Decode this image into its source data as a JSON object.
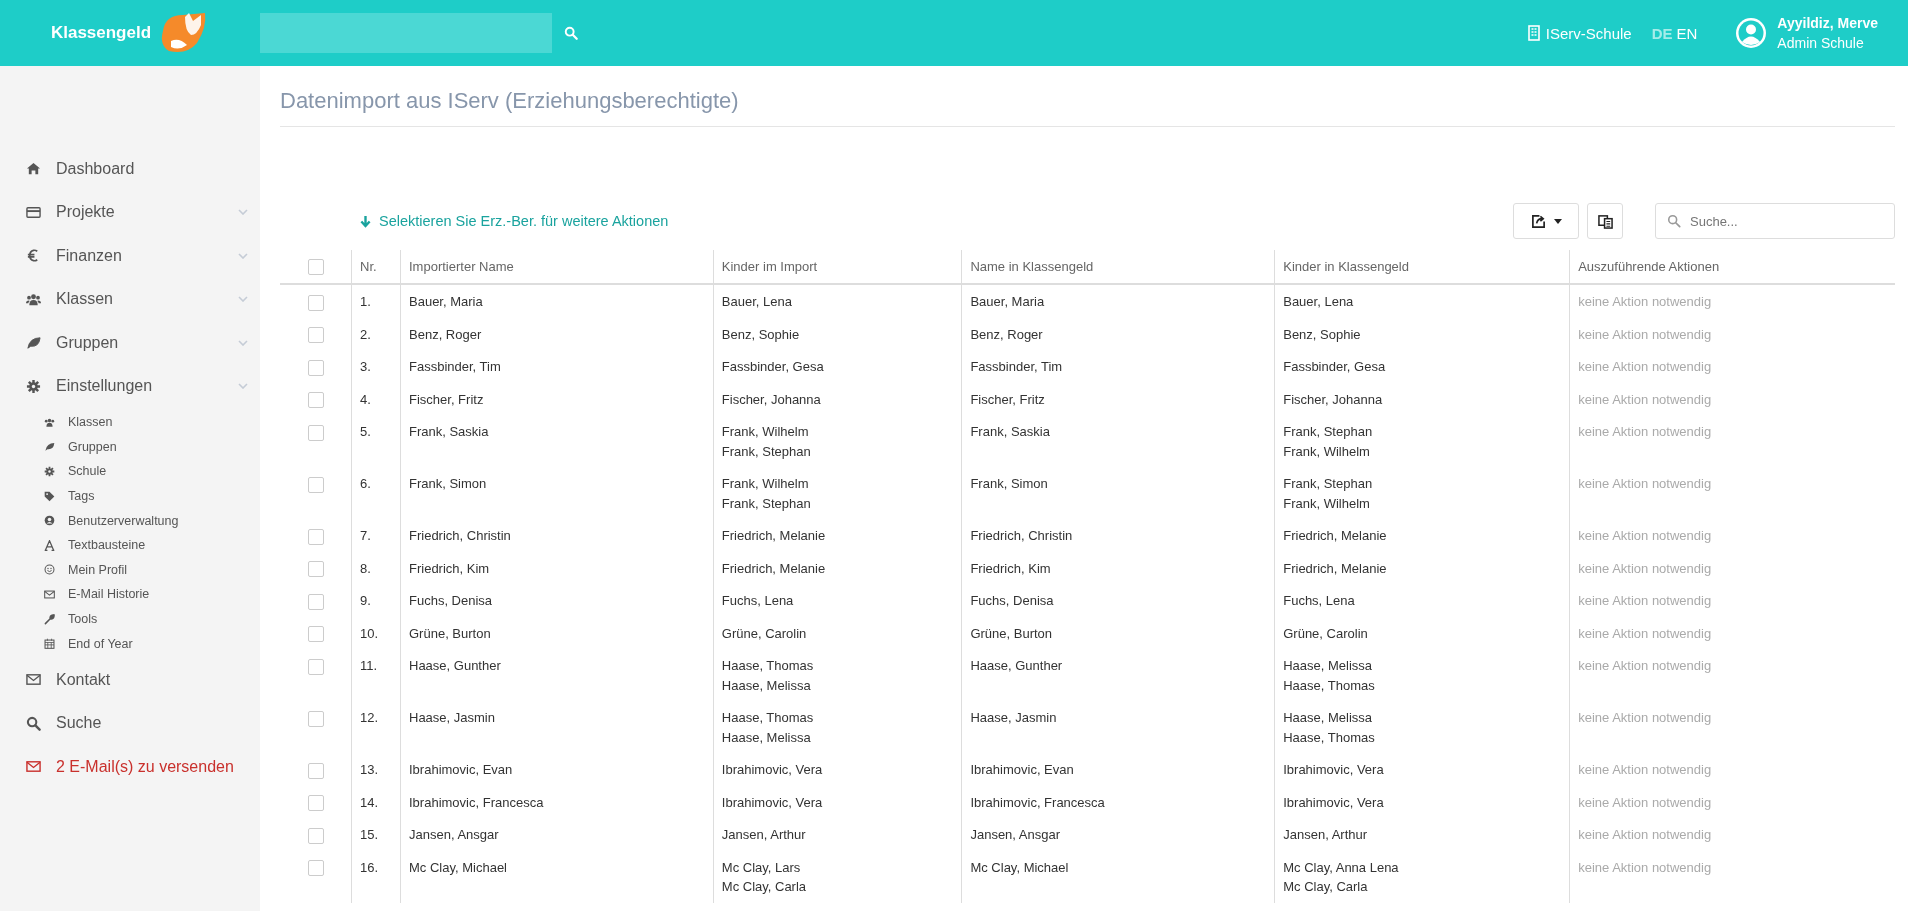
{
  "header": {
    "logo": "Klassengeld",
    "school": "IServ-Schule",
    "languages": [
      {
        "label": "DE",
        "selected": true
      },
      {
        "label": "EN",
        "selected": false
      }
    ],
    "user": {
      "name": "Ayyildiz, Merve",
      "role": "Admin Schule"
    }
  },
  "sidebar": {
    "items": [
      {
        "label": "Dashboard",
        "kind": "link",
        "expandable": false
      },
      {
        "label": "Projekte",
        "kind": "link",
        "expandable": true
      },
      {
        "label": "Finanzen",
        "kind": "link",
        "expandable": true
      },
      {
        "label": "Klassen",
        "kind": "link",
        "expandable": true
      },
      {
        "label": "Gruppen",
        "kind": "link",
        "expandable": true
      },
      {
        "label": "Einstellungen",
        "kind": "link",
        "expandable": true,
        "children": [
          {
            "label": "Klassen"
          },
          {
            "label": "Gruppen"
          },
          {
            "label": "Schule"
          },
          {
            "label": "Tags"
          },
          {
            "label": "Benutzerverwaltung"
          },
          {
            "label": "Textbausteine"
          },
          {
            "label": "Mein Profil"
          },
          {
            "label": "E-Mail Historie"
          },
          {
            "label": "Tools"
          },
          {
            "label": "End of Year"
          }
        ]
      },
      {
        "label": "Kontakt",
        "kind": "link",
        "expandable": false
      },
      {
        "label": "Suche",
        "kind": "link",
        "expandable": false
      },
      {
        "label": "2 E-Mail(s) zu versenden",
        "kind": "alert",
        "expandable": false
      }
    ]
  },
  "page": {
    "title": "Datenimport aus IServ (Erziehungsberechtigte)",
    "hint": "Selektieren Sie Erz.-Ber. für weitere Aktionen",
    "search": {
      "placeholder": "Suche..."
    }
  },
  "table": {
    "select_all": {
      "checked": false
    },
    "columns": [
      "Nr.",
      "Importierter Name",
      "Kinder im Import",
      "Name in Klassengeld",
      "Kinder in Klassengeld",
      "Auszuführende Aktionen"
    ],
    "rows": [
      {
        "checked": false,
        "nr": "1.",
        "name": "Bauer, Maria",
        "kids_import": [
          "Bauer, Lena"
        ],
        "name_kg": "Bauer, Maria",
        "kids_kg": [
          "Bauer, Lena"
        ],
        "action": "keine Aktion notwendig"
      },
      {
        "checked": false,
        "nr": "2.",
        "name": "Benz, Roger",
        "kids_import": [
          "Benz, Sophie"
        ],
        "name_kg": "Benz, Roger",
        "kids_kg": [
          "Benz, Sophie"
        ],
        "action": "keine Aktion notwendig"
      },
      {
        "checked": false,
        "nr": "3.",
        "name": "Fassbinder, Tim",
        "kids_import": [
          "Fassbinder, Gesa"
        ],
        "name_kg": "Fassbinder, Tim",
        "kids_kg": [
          "Fassbinder, Gesa"
        ],
        "action": "keine Aktion notwendig"
      },
      {
        "checked": false,
        "nr": "4.",
        "name": "Fischer, Fritz",
        "kids_import": [
          "Fischer, Johanna"
        ],
        "name_kg": "Fischer, Fritz",
        "kids_kg": [
          "Fischer, Johanna"
        ],
        "action": "keine Aktion notwendig"
      },
      {
        "checked": false,
        "nr": "5.",
        "name": "Frank, Saskia",
        "kids_import": [
          "Frank, Wilhelm",
          "Frank, Stephan"
        ],
        "name_kg": "Frank, Saskia",
        "kids_kg": [
          "Frank, Stephan",
          "Frank, Wilhelm"
        ],
        "action": "keine Aktion notwendig"
      },
      {
        "checked": false,
        "nr": "6.",
        "name": "Frank, Simon",
        "kids_import": [
          "Frank, Wilhelm",
          "Frank, Stephan"
        ],
        "name_kg": "Frank, Simon",
        "kids_kg": [
          "Frank, Stephan",
          "Frank, Wilhelm"
        ],
        "action": "keine Aktion notwendig"
      },
      {
        "checked": false,
        "nr": "7.",
        "name": "Friedrich, Christin",
        "kids_import": [
          "Friedrich, Melanie"
        ],
        "name_kg": "Friedrich, Christin",
        "kids_kg": [
          "Friedrich, Melanie"
        ],
        "action": "keine Aktion notwendig"
      },
      {
        "checked": false,
        "nr": "8.",
        "name": "Friedrich, Kim",
        "kids_import": [
          "Friedrich, Melanie"
        ],
        "name_kg": "Friedrich, Kim",
        "kids_kg": [
          "Friedrich, Melanie"
        ],
        "action": "keine Aktion notwendig"
      },
      {
        "checked": false,
        "nr": "9.",
        "name": "Fuchs, Denisa",
        "kids_import": [
          "Fuchs, Lena"
        ],
        "name_kg": "Fuchs, Denisa",
        "kids_kg": [
          "Fuchs, Lena"
        ],
        "action": "keine Aktion notwendig"
      },
      {
        "checked": false,
        "nr": "10.",
        "name": "Grüne, Burton",
        "kids_import": [
          "Grüne, Carolin"
        ],
        "name_kg": "Grüne, Burton",
        "kids_kg": [
          "Grüne, Carolin"
        ],
        "action": "keine Aktion notwendig"
      },
      {
        "checked": false,
        "nr": "11.",
        "name": "Haase, Gunther",
        "kids_import": [
          "Haase, Thomas",
          "Haase, Melissa"
        ],
        "name_kg": "Haase, Gunther",
        "kids_kg": [
          "Haase, Melissa",
          "Haase, Thomas"
        ],
        "action": "keine Aktion notwendig"
      },
      {
        "checked": false,
        "nr": "12.",
        "name": "Haase, Jasmin",
        "kids_import": [
          "Haase, Thomas",
          "Haase, Melissa"
        ],
        "name_kg": "Haase, Jasmin",
        "kids_kg": [
          "Haase, Melissa",
          "Haase, Thomas"
        ],
        "action": "keine Aktion notwendig"
      },
      {
        "checked": false,
        "nr": "13.",
        "name": "Ibrahimovic, Evan",
        "kids_import": [
          "Ibrahimovic, Vera"
        ],
        "name_kg": "Ibrahimovic, Evan",
        "kids_kg": [
          "Ibrahimovic, Vera"
        ],
        "action": "keine Aktion notwendig"
      },
      {
        "checked": false,
        "nr": "14.",
        "name": "Ibrahimovic, Francesca",
        "kids_import": [
          "Ibrahimovic, Vera"
        ],
        "name_kg": "Ibrahimovic, Francesca",
        "kids_kg": [
          "Ibrahimovic, Vera"
        ],
        "action": "keine Aktion notwendig"
      },
      {
        "checked": false,
        "nr": "15.",
        "name": "Jansen, Ansgar",
        "kids_import": [
          "Jansen, Arthur"
        ],
        "name_kg": "Jansen, Ansgar",
        "kids_kg": [
          "Jansen, Arthur"
        ],
        "action": "keine Aktion notwendig"
      },
      {
        "checked": false,
        "nr": "16.",
        "name": "Mc Clay, Michael",
        "kids_import": [
          "Mc Clay, Lars",
          "Mc Clay, Carla"
        ],
        "name_kg": "Mc Clay, Michael",
        "kids_kg": [
          "Mc Clay, Anna Lena",
          "Mc Clay, Carla"
        ],
        "action": "keine Aktion notwendig"
      }
    ]
  }
}
